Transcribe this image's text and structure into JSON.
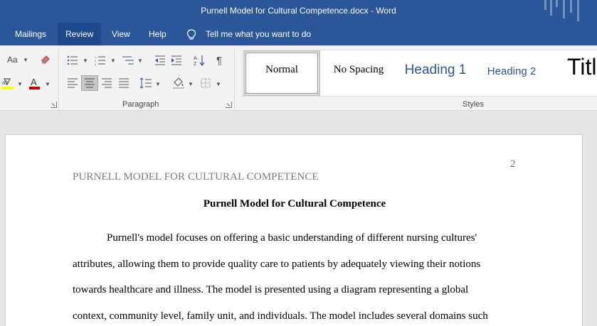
{
  "window": {
    "title": "Purnell Model for Cultural Competence.docx  -  Word"
  },
  "menu": {
    "tabs": [
      {
        "label": "Mailings",
        "active": false
      },
      {
        "label": "Review",
        "active": true
      },
      {
        "label": "View",
        "active": false
      },
      {
        "label": "Help",
        "active": false
      }
    ],
    "tell_me": "Tell me what you want to do"
  },
  "ribbon": {
    "font_group": {
      "change_case": "Aa"
    },
    "paragraph_group": {
      "label": "Paragraph"
    },
    "styles_group": {
      "label": "Styles",
      "items": [
        {
          "label": "Normal",
          "selected": true
        },
        {
          "label": "No Spacing",
          "selected": false
        },
        {
          "label": "Heading 1",
          "selected": false
        },
        {
          "label": "Heading 2",
          "selected": false
        },
        {
          "label": "Title",
          "selected": false
        }
      ]
    }
  },
  "document": {
    "page_number": "2",
    "running_head": "PURNELL MODEL FOR CULTURAL COMPETENCE",
    "title": "Purnell Model for Cultural Competence",
    "lines": [
      "Purnell's model focuses on offering a basic understanding of different nursing cultures'",
      "attributes, allowing them to provide quality care to patients by adequately viewing their notions",
      "towards healthcare and illness. The model is presented using a diagram representing a global",
      "context, community level, family unit, and individuals. The model includes several domains such"
    ]
  },
  "colors": {
    "title_bar": "#2b579a",
    "active_tab": "#1e4a8c",
    "ribbon_bg": "#f3f3f3",
    "heading_blue": "#2f5496",
    "highlight_yellow": "#ffff00",
    "font_color_red": "#c00000"
  }
}
